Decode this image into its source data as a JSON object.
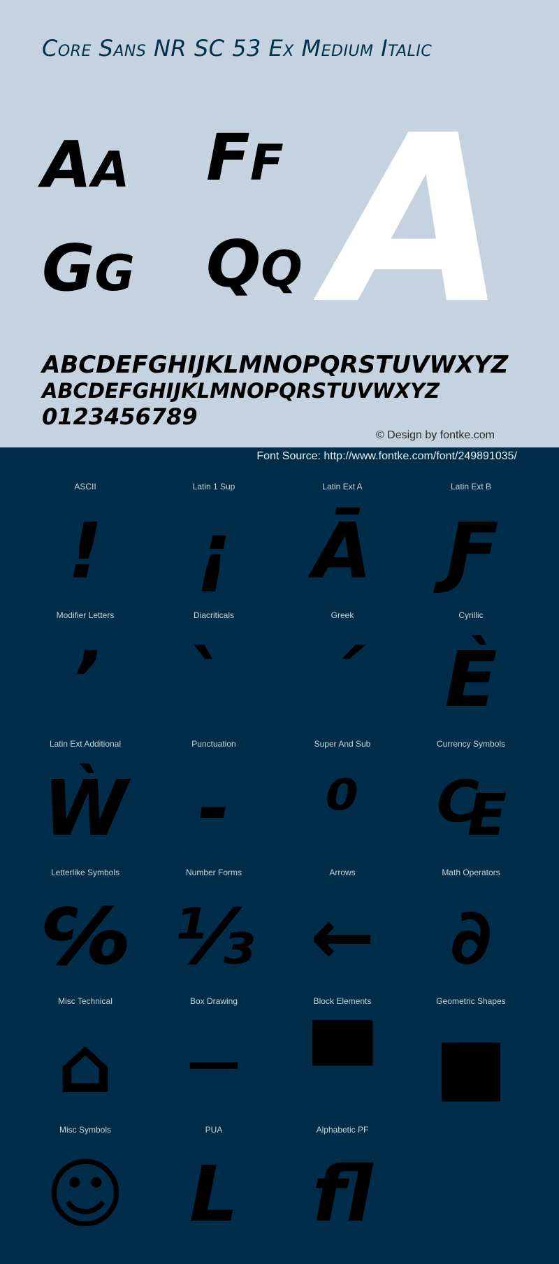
{
  "header": {
    "title": "Core Sans NR SC 53 Ex Medium Italic"
  },
  "specimen": {
    "pairs": [
      {
        "upper": "A",
        "lower": "A"
      },
      {
        "upper": "F",
        "lower": "F"
      },
      {
        "upper": "G",
        "lower": "G"
      },
      {
        "upper": "Q",
        "lower": "Q"
      }
    ],
    "big_glyph": "A",
    "alphabet_upper": "ABCDEFGHIJKLMNOPQRSTUVWXYZ",
    "alphabet_lower": "ABCDEFGHIJKLMNOPQRSTUVWXYZ",
    "digits": "0123456789",
    "credit": "© Design by fontke.com",
    "source": "Font Source: http://www.fontke.com/font/249891035/"
  },
  "colors": {
    "top_background": "#c4d3df",
    "bottom_background": "#002e4a",
    "title": "#00304a",
    "big_glyph": "#ffffff"
  },
  "blocks": [
    {
      "label": "ASCII",
      "glyph": "!"
    },
    {
      "label": "Latin 1 Sup",
      "glyph": "¡"
    },
    {
      "label": "Latin Ext A",
      "glyph": "Ā"
    },
    {
      "label": "Latin Ext B",
      "glyph": "Ƒ"
    },
    {
      "label": "Modifier Letters",
      "glyph": "ʼ"
    },
    {
      "label": "Diacriticals",
      "glyph": "̀"
    },
    {
      "label": "Greek",
      "glyph": "΄"
    },
    {
      "label": "Cyrillic",
      "glyph": "Ѐ"
    },
    {
      "label": "Latin Ext Additional",
      "glyph": "Ẁ"
    },
    {
      "label": "Punctuation",
      "glyph": "‐"
    },
    {
      "label": "Super And Sub",
      "glyph": "⁰"
    },
    {
      "label": "Currency Symbols",
      "glyph": "₠"
    },
    {
      "label": "Letterlike Symbols",
      "glyph": "℅"
    },
    {
      "label": "Number Forms",
      "glyph": "⅓"
    },
    {
      "label": "Arrows",
      "glyph": "←"
    },
    {
      "label": "Math Operators",
      "glyph": "∂"
    },
    {
      "label": "Misc Technical",
      "glyph": "⌂"
    },
    {
      "label": "Box Drawing",
      "glyph": "─"
    },
    {
      "label": "Block Elements",
      "glyph": "▀"
    },
    {
      "label": "Geometric Shapes",
      "glyph": "■"
    },
    {
      "label": "Misc Symbols",
      "glyph": "☺"
    },
    {
      "label": "PUA",
      "glyph": "L"
    },
    {
      "label": "Alphabetic PF",
      "glyph": "ﬂ"
    }
  ]
}
